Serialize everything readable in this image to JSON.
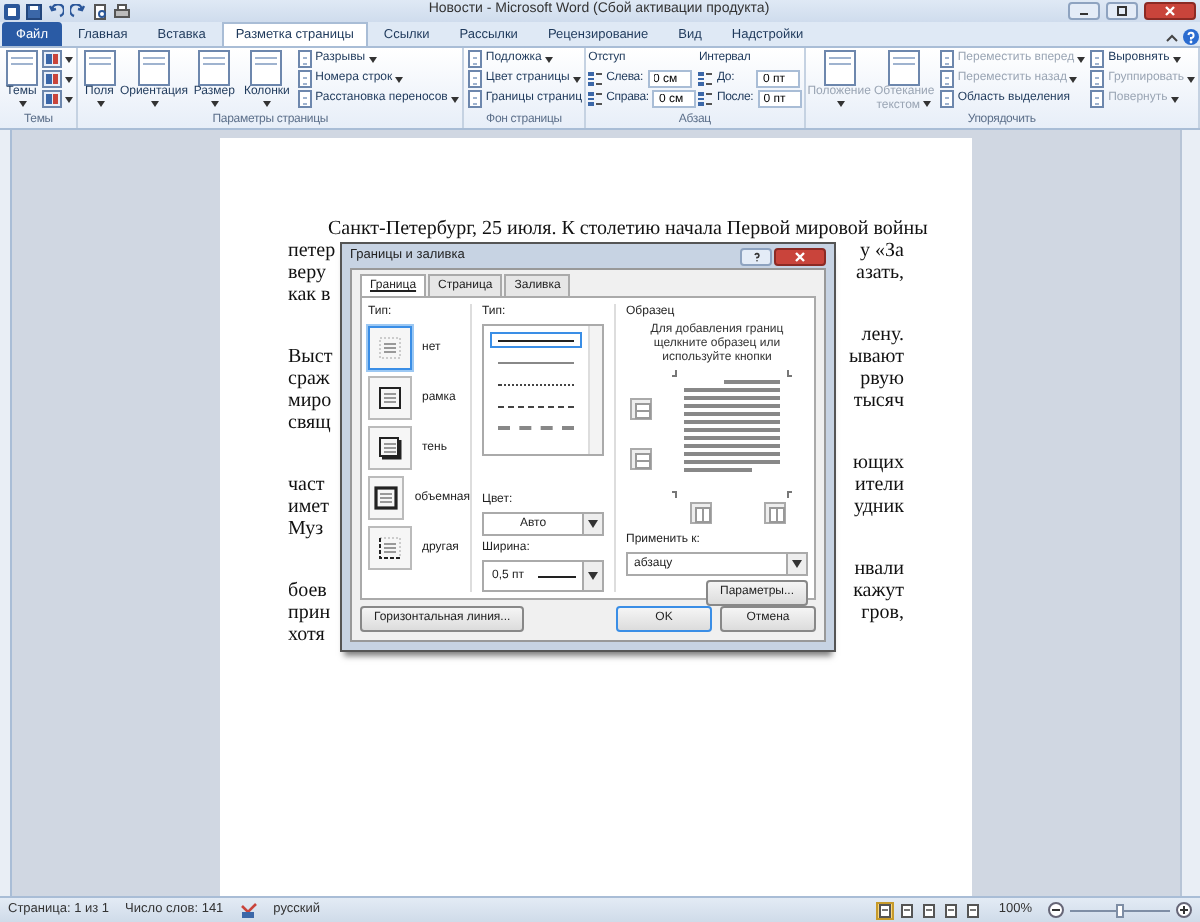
{
  "window": {
    "title": "Новости - Microsoft Word (Сбой активации продукта)"
  },
  "ribbon_tabs": [
    {
      "label": "Файл",
      "kind": "file",
      "selected": false
    },
    {
      "label": "Главная",
      "kind": "tab",
      "selected": false
    },
    {
      "label": "Вставка",
      "kind": "tab",
      "selected": false
    },
    {
      "label": "Разметка страницы",
      "kind": "tab",
      "selected": true
    },
    {
      "label": "Ссылки",
      "kind": "tab",
      "selected": false
    },
    {
      "label": "Рассылки",
      "kind": "tab",
      "selected": false
    },
    {
      "label": "Рецензирование",
      "kind": "tab",
      "selected": false
    },
    {
      "label": "Вид",
      "kind": "tab",
      "selected": false
    },
    {
      "label": "Надстройки",
      "kind": "tab",
      "selected": false
    }
  ],
  "ribbon_groups": [
    {
      "label": "Темы",
      "columns": [
        [
          {
            "kind": "large",
            "label": "Темы",
            "dropdown": true,
            "disabled": false
          }
        ],
        [
          {
            "kind": "icon",
            "dropdown": true,
            "disabled": false
          },
          {
            "kind": "icon",
            "dropdown": true,
            "disabled": false
          },
          {
            "kind": "icon",
            "dropdown": true,
            "disabled": false
          }
        ]
      ]
    },
    {
      "label": "Параметры страницы",
      "columns": [
        [
          {
            "kind": "large",
            "label": "Поля",
            "dropdown": true,
            "disabled": false
          }
        ],
        [
          {
            "kind": "large",
            "label": "Ориентация",
            "dropdown": true,
            "disabled": false
          }
        ],
        [
          {
            "kind": "large",
            "label": "Размер",
            "dropdown": true,
            "disabled": false
          }
        ],
        [
          {
            "kind": "large",
            "label": "Колонки",
            "dropdown": true,
            "disabled": false
          }
        ],
        [
          {
            "kind": "small",
            "label": "Разрывы",
            "dropdown": true,
            "disabled": false
          },
          {
            "kind": "small",
            "label": "Номера строк",
            "dropdown": true,
            "disabled": false
          },
          {
            "kind": "small",
            "label": "Расстановка переносов",
            "dropdown": true,
            "disabled": false
          }
        ]
      ]
    },
    {
      "label": "Фон страницы",
      "columns": [
        [
          {
            "kind": "small",
            "label": "Подложка",
            "dropdown": true,
            "disabled": false
          },
          {
            "kind": "small",
            "label": "Цвет страницы",
            "dropdown": true,
            "disabled": false
          },
          {
            "kind": "small",
            "label": "Границы страниц",
            "dropdown": false,
            "disabled": false
          }
        ]
      ]
    },
    {
      "label": "Абзац",
      "columns": [
        [
          {
            "kind": "heading",
            "label": "Отступ"
          },
          {
            "kind": "spin",
            "label": "Слева:",
            "value": "0 см"
          },
          {
            "kind": "spin",
            "label": "Справа:",
            "value": "0 см"
          }
        ],
        [
          {
            "kind": "heading",
            "label": "Интервал"
          },
          {
            "kind": "spin",
            "label": "До:",
            "value": "0 пт"
          },
          {
            "kind": "spin",
            "label": "После:",
            "value": "0 пт"
          }
        ]
      ]
    },
    {
      "label": "Упорядочить",
      "columns": [
        [
          {
            "kind": "large",
            "label": "Положение",
            "dropdown": true,
            "disabled": true
          }
        ],
        [
          {
            "kind": "large",
            "label": "Обтекание текстом",
            "dropdown": true,
            "disabled": true
          }
        ],
        [
          {
            "kind": "small",
            "label": "Переместить вперед",
            "dropdown": true,
            "disabled": true
          },
          {
            "kind": "small",
            "label": "Переместить назад",
            "dropdown": true,
            "disabled": true
          },
          {
            "kind": "small",
            "label": "Область выделения",
            "dropdown": false,
            "disabled": false
          }
        ],
        [
          {
            "kind": "small",
            "label": "Выровнять",
            "dropdown": true,
            "disabled": false
          },
          {
            "kind": "small",
            "label": "Группировать",
            "dropdown": true,
            "disabled": true
          },
          {
            "kind": "small",
            "label": "Повернуть",
            "dropdown": true,
            "disabled": true
          }
        ]
      ]
    }
  ],
  "document": {
    "paragraphs": [
      [
        {
          "left": "Санкт-Петербург, 25 июля. К столетию начала Первой мировой войны",
          "indent": true
        },
        {
          "left": "петер",
          "right": "у «За"
        },
        {
          "left": "веру",
          "right": "азать,"
        },
        {
          "left": "как в"
        }
      ],
      [
        {
          "right": "лену."
        },
        {
          "left": "Выст",
          "right": "ывают"
        },
        {
          "left": "сраж",
          "right": "рвую"
        },
        {
          "left": "миро",
          "right": "тысяч"
        },
        {
          "left": "свящ"
        }
      ],
      [
        {
          "right": "ющих"
        },
        {
          "left": "част",
          "right": "ители"
        },
        {
          "left": "имет",
          "right": "удник"
        },
        {
          "left": "Муз"
        }
      ],
      [
        {
          "right": "нвали"
        },
        {
          "left": "боев",
          "right": "кажут"
        },
        {
          "left": "прин",
          "right": "гров,"
        },
        {
          "left": "хотя"
        }
      ]
    ]
  },
  "dialog": {
    "title": "Границы и заливка",
    "tabs": [
      {
        "label": "Граница",
        "selected": true
      },
      {
        "label": "Страница",
        "selected": false
      },
      {
        "label": "Заливка",
        "selected": false
      }
    ],
    "presets_label": "Тип:",
    "presets": [
      {
        "label": "нет",
        "kind": "none",
        "selected": true
      },
      {
        "label": "рамка",
        "kind": "box",
        "selected": false
      },
      {
        "label": "тень",
        "kind": "shadow",
        "selected": false
      },
      {
        "label": "объемная",
        "kind": "raised",
        "selected": false
      },
      {
        "label": "другая",
        "kind": "custom",
        "selected": false
      }
    ],
    "style_label": "Тип:",
    "line_styles": [
      {
        "kind": "solid",
        "selected": true
      },
      {
        "kind": "thin",
        "selected": false
      },
      {
        "kind": "dotted",
        "selected": false
      },
      {
        "kind": "dashed",
        "selected": false
      },
      {
        "kind": "dashdot",
        "selected": false
      }
    ],
    "color_label": "Цвет:",
    "color_value": "Авто",
    "width_label": "Ширина:",
    "width_value": "0,5 пт",
    "preview_label": "Образец",
    "preview_hint": "Для добавления границ щелкните образец или используйте кнопки",
    "apply_label": "Применить к:",
    "apply_value": "абзацу",
    "options_button": "Параметры...",
    "horizontal_line_button": "Горизонтальная линия...",
    "ok_button": "OK",
    "cancel_button": "Отмена"
  },
  "status_bar": {
    "page": "Страница: 1 из 1",
    "words": "Число слов: 141",
    "language": "русский",
    "views": [
      {
        "selected": true
      },
      {
        "selected": false
      },
      {
        "selected": false
      },
      {
        "selected": false
      },
      {
        "selected": false
      }
    ],
    "zoom": "100%",
    "zoom_slider": {
      "level": 0.5
    }
  }
}
